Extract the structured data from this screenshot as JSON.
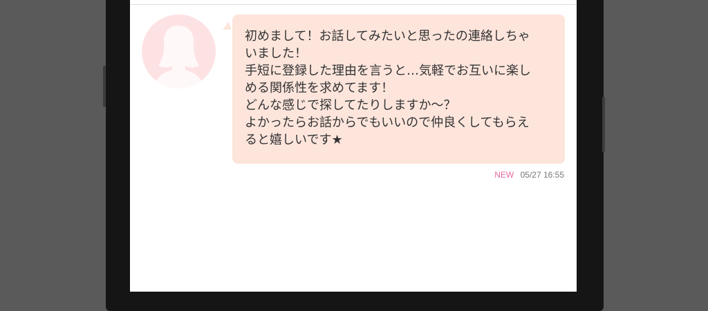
{
  "message": {
    "lines": [
      "初めまして！お話してみたいと思ったの連絡しちゃ",
      "いました！",
      "手短に登録した理由を言うと…気軽でお互いに楽し",
      "める関係性を求めてます！",
      "どんな感じで探してたりしますか〜？",
      "よかったらお話からでもいいので仲良くしてもらえ",
      "ると嬉しいです★"
    ],
    "new_badge": "NEW",
    "timestamp": "05/27 16:55"
  },
  "colors": {
    "bubble": "#fde5dc",
    "avatar_bg": "#fde2e4",
    "new_badge": "#e36aa3"
  },
  "icons": {
    "avatar": "female-silhouette-icon"
  }
}
